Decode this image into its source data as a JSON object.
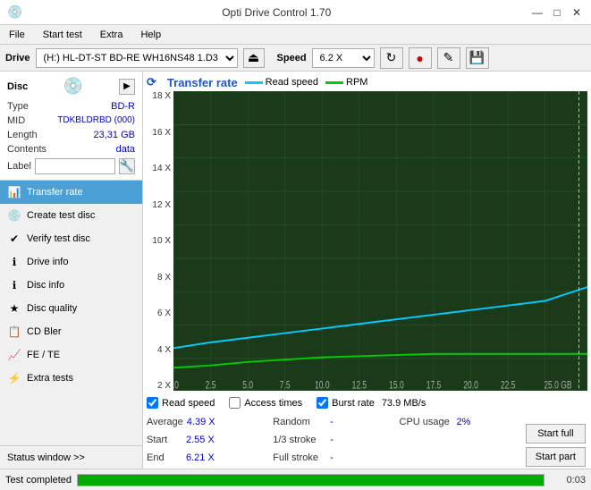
{
  "app": {
    "title": "Opti Drive Control 1.70",
    "title_controls": {
      "minimize": "—",
      "maximize": "□",
      "close": "✕"
    }
  },
  "menu": {
    "items": [
      "File",
      "Start test",
      "Extra",
      "Help"
    ]
  },
  "drive_bar": {
    "drive_label": "Drive",
    "drive_value": "(H:) HL-DT-ST BD-RE  WH16NS48 1.D3",
    "speed_label": "Speed",
    "speed_value": "6.2 X  ▼"
  },
  "disc_panel": {
    "title": "Disc",
    "rows": [
      {
        "key": "Type",
        "val": "BD-R",
        "colored": true
      },
      {
        "key": "MID",
        "val": "TDKBLDRBD (000)",
        "colored": true
      },
      {
        "key": "Length",
        "val": "23,31 GB",
        "colored": true
      },
      {
        "key": "Contents",
        "val": "data",
        "colored": true
      },
      {
        "key": "Label",
        "val": "",
        "is_input": true
      }
    ]
  },
  "nav": {
    "items": [
      {
        "label": "Transfer rate",
        "active": true
      },
      {
        "label": "Create test disc",
        "active": false
      },
      {
        "label": "Verify test disc",
        "active": false
      },
      {
        "label": "Drive info",
        "active": false
      },
      {
        "label": "Disc info",
        "active": false
      },
      {
        "label": "Disc quality",
        "active": false
      },
      {
        "label": "CD Bler",
        "active": false
      },
      {
        "label": "FE / TE",
        "active": false
      },
      {
        "label": "Extra tests",
        "active": false
      }
    ],
    "status_window": "Status window >> "
  },
  "chart": {
    "title": "Transfer rate",
    "legend": [
      {
        "label": "Read speed",
        "color": "#00ccff"
      },
      {
        "label": "RPM",
        "color": "#00cc00"
      }
    ],
    "y_axis": [
      "18 X",
      "16 X",
      "14 X",
      "12 X",
      "10 X",
      "8 X",
      "6 X",
      "4 X",
      "2 X"
    ],
    "x_axis": [
      "0.0",
      "2.5",
      "5.0",
      "7.5",
      "10.0",
      "12.5",
      "15.0",
      "17.5",
      "20.0",
      "22.5",
      "25.0 GB"
    ]
  },
  "checkboxes": {
    "read_speed": {
      "label": "Read speed",
      "checked": true
    },
    "access_times": {
      "label": "Access times",
      "checked": false
    },
    "burst_rate": {
      "label": "Burst rate",
      "checked": true,
      "value": "73.9 MB/s"
    }
  },
  "stats": {
    "col1": [
      {
        "label": "Average",
        "val": "4.39 X"
      },
      {
        "label": "Start",
        "val": "2.55 X"
      },
      {
        "label": "End",
        "val": "6.21 X"
      }
    ],
    "col2": [
      {
        "label": "Random",
        "val": "—"
      },
      {
        "label": "1/3 stroke",
        "val": "—"
      },
      {
        "label": "Full stroke",
        "val": "—"
      }
    ],
    "col3": [
      {
        "label": "CPU usage",
        "val": "2%"
      },
      {
        "label": "",
        "val": ""
      },
      {
        "label": "",
        "val": ""
      }
    ],
    "buttons": [
      {
        "label": "Start full"
      },
      {
        "label": "Start part"
      }
    ]
  },
  "status_bar": {
    "text": "Test completed",
    "progress": 100,
    "time": "0:03"
  }
}
